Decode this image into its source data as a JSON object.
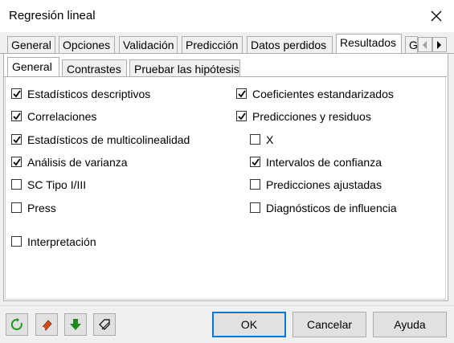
{
  "window": {
    "title": "Regresión lineal"
  },
  "tabs": [
    "General",
    "Opciones",
    "Validación",
    "Predicción",
    "Datos perdidos",
    "Resultados",
    "G"
  ],
  "active_tab": "Resultados",
  "subtabs": [
    "General",
    "Contrastes",
    "Pruebar las hipótesis"
  ],
  "active_subtab": "General",
  "options_left": [
    {
      "label": "Estadísticos descriptivos",
      "checked": true
    },
    {
      "label": "Correlaciones",
      "checked": true
    },
    {
      "label": "Estadísticos de multicolinealidad",
      "checked": true
    },
    {
      "label": "Análisis de varianza",
      "checked": true
    },
    {
      "label": "SC Tipo I/III",
      "checked": false
    },
    {
      "label": "Press",
      "checked": false
    },
    {
      "label": "Interpretación",
      "checked": false
    }
  ],
  "options_right": [
    {
      "label": "Coeficientes estandarizados",
      "checked": true
    },
    {
      "label": "Predicciones y residuos",
      "checked": true
    },
    {
      "label": "X",
      "checked": false
    },
    {
      "label": "Intervalos de confianza",
      "checked": true
    },
    {
      "label": "Predicciones ajustadas",
      "checked": false
    },
    {
      "label": "Diagnósticos de influencia",
      "checked": false
    }
  ],
  "buttons": {
    "ok": "OK",
    "cancel": "Cancelar",
    "help": "Ayuda"
  },
  "icons": [
    "reset-icon",
    "eraser-icon",
    "download-arrow-icon",
    "clear-tag-icon"
  ],
  "colors": {
    "accent": "#0078d7",
    "reset": "#1a9a1a",
    "arrow": "#1a8a1a",
    "eraser": "#d04a1a"
  }
}
